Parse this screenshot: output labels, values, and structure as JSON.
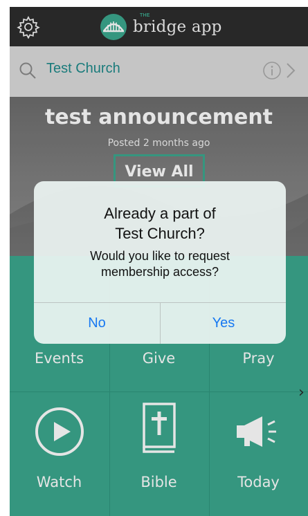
{
  "header": {
    "brand_small": "THE",
    "brand_name": "bridge app",
    "settings_icon": "gear-icon",
    "logo_icon": "bridge-logo-icon"
  },
  "search": {
    "church_name": "Test Church",
    "search_icon": "search-icon",
    "info_icon": "info-icon",
    "next_icon": "chevron-right-icon"
  },
  "announcement": {
    "title": "test announcement",
    "posted": "Posted 2 months ago",
    "view_all_label": "View All"
  },
  "tiles": [
    {
      "label": "Events",
      "icon": "calendar-icon"
    },
    {
      "label": "Give",
      "icon": "give-icon"
    },
    {
      "label": "Pray",
      "icon": "pray-icon"
    },
    {
      "label": "Watch",
      "icon": "play-icon"
    },
    {
      "label": "Bible",
      "icon": "bible-icon"
    },
    {
      "label": "Today",
      "icon": "megaphone-icon"
    }
  ],
  "pager_arrow": "›",
  "dialog": {
    "title_line1": "Already a part of",
    "title_line2": "Test Church?",
    "message_line1": "Would you like to request",
    "message_line2": "membership access?",
    "no_label": "No",
    "yes_label": "Yes"
  },
  "colors": {
    "accent": "#3ba88e",
    "topbar": "#2d2d2d",
    "link_blue": "#1778f2",
    "church_name": "#1e8a8a"
  }
}
